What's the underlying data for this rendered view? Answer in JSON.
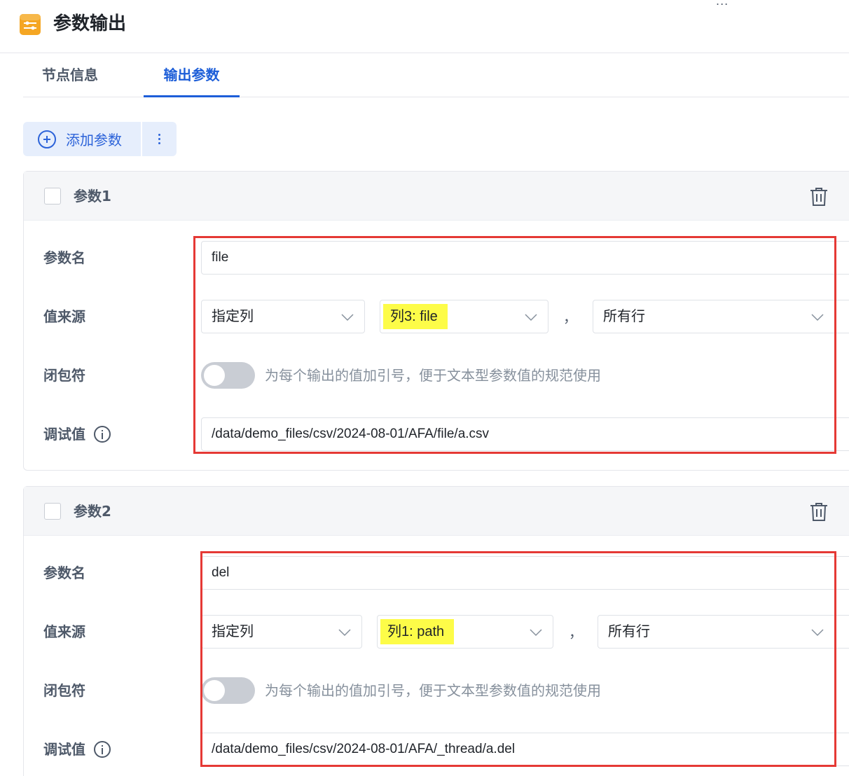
{
  "header": {
    "title": "参数输出",
    "icon": "sliders-icon",
    "more": "..."
  },
  "tabs": [
    {
      "label": "节点信息",
      "active": false
    },
    {
      "label": "输出参数",
      "active": true
    }
  ],
  "toolbar": {
    "add_label": "添加参数",
    "more_icon": "more-vertical-icon"
  },
  "fields": {
    "name_label": "参数名",
    "source_label": "值来源",
    "quote_label": "闭包符",
    "debug_label": "调试值",
    "quote_hint": "为每个输出的值加引号，便于文本型参数值的规范使用",
    "separator": "，"
  },
  "params": [
    {
      "title": "参数1",
      "name": "file",
      "source_type": "指定列",
      "column": "列3: file",
      "rows": "所有行",
      "quote_enabled": false,
      "debug_value": "/data/demo_files/csv/2024-08-01/AFA/file/a.csv"
    },
    {
      "title": "参数2",
      "name": "del",
      "source_type": "指定列",
      "column": "列1: path",
      "rows": "所有行",
      "quote_enabled": false,
      "debug_value": "/data/demo_files/csv/2024-08-01/AFA/_thread/a.del"
    }
  ],
  "colors": {
    "accent": "#1d5ed8",
    "highlight": "#fdfc48",
    "annotation": "#e53935"
  }
}
